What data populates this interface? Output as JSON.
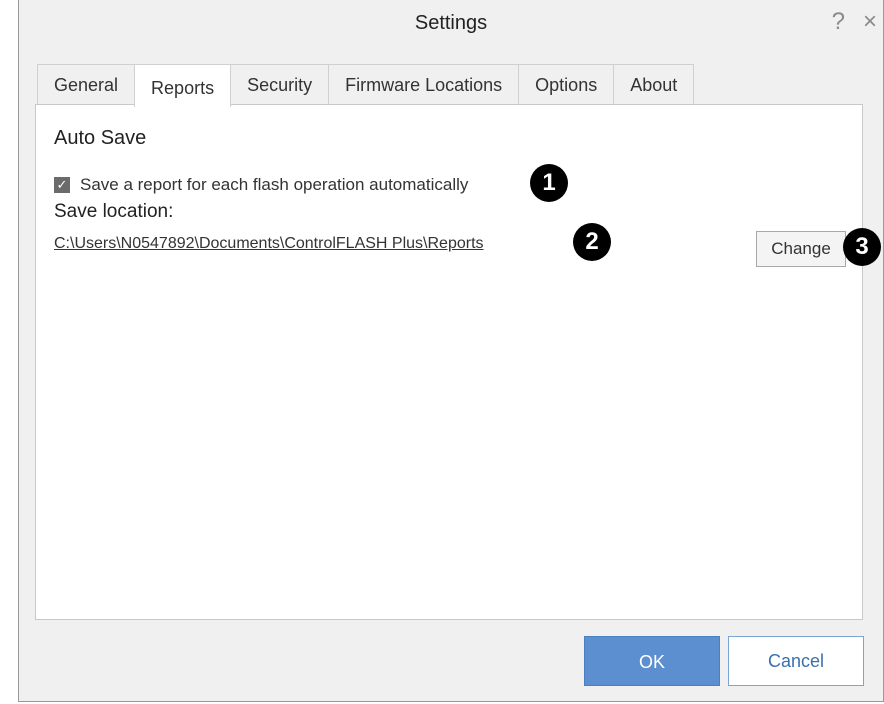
{
  "window": {
    "title": "Settings",
    "help_glyph": "?",
    "close_glyph": "×"
  },
  "tabs": [
    {
      "label": "General",
      "active": false
    },
    {
      "label": "Reports",
      "active": true
    },
    {
      "label": "Security",
      "active": false
    },
    {
      "label": "Firmware Locations",
      "active": false
    },
    {
      "label": "Options",
      "active": false
    },
    {
      "label": "About",
      "active": false
    }
  ],
  "reports": {
    "section_title": "Auto Save",
    "auto_save_checkbox": {
      "label": "Save a report for each flash operation automatically",
      "checked": true,
      "check_glyph": "✓"
    },
    "save_location_label": "Save location:",
    "save_path": "C:\\Users\\N0547892\\Documents\\ControlFLASH Plus\\Reports",
    "change_label": "Change"
  },
  "callouts": [
    "1",
    "2",
    "3"
  ],
  "footer": {
    "ok_label": "OK",
    "cancel_label": "Cancel"
  },
  "colors": {
    "primary_button": "#5b8fd0",
    "cancel_text": "#3a6fb0",
    "callout_bg": "#000000"
  }
}
